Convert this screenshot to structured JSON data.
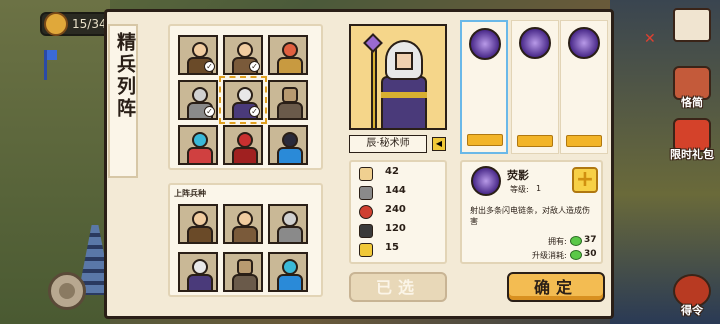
{
  "hud": {
    "counter": "15/34",
    "home_label": "",
    "book_label": "恪简",
    "gift_label": "限时礼包",
    "order_label": "得令"
  },
  "panel": {
    "title": "精兵列阵",
    "lineup_label": "上阵兵种",
    "unit_name": "辰·秘术师",
    "stats": [
      {
        "icon": "sword-icon",
        "value": "42",
        "color": "#f0d090"
      },
      {
        "icon": "shield-icon",
        "value": "144",
        "color": "#8a8a8a"
      },
      {
        "icon": "heart-icon",
        "value": "240",
        "color": "#d04030"
      },
      {
        "icon": "boot-icon",
        "value": "120",
        "color": "#3a3a3a"
      },
      {
        "icon": "lightning-icon",
        "value": "15",
        "color": "#f0c838"
      }
    ],
    "skill": {
      "name": "荧影",
      "level_label": "等级:",
      "level": "1",
      "desc": "射出多条闪电链条，对敌人造成伤害",
      "own_label": "拥有:",
      "own_value": "37",
      "cost_label": "升级消耗:",
      "cost_value": "30"
    },
    "buttons": {
      "chosen": "已选",
      "confirm": "确定"
    }
  }
}
